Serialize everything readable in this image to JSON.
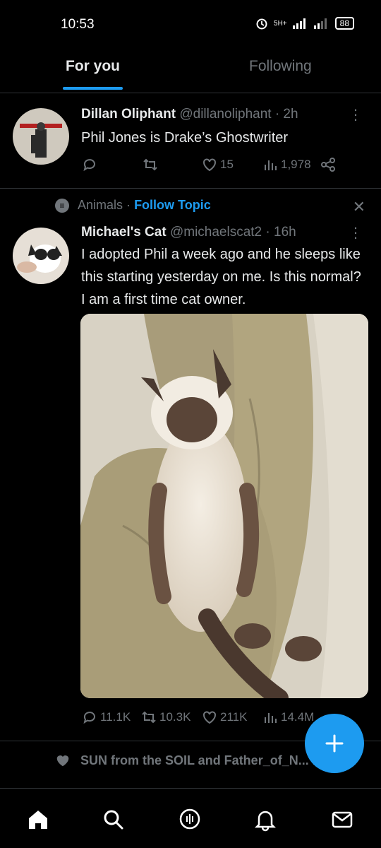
{
  "status_bar": {
    "time": "10:53",
    "network": "5H+",
    "battery": "88"
  },
  "tabs": [
    {
      "label": "For you",
      "active": true
    },
    {
      "label": "Following",
      "active": false
    }
  ],
  "tweet1": {
    "name": "Dillan Oliphant",
    "handle": "@dillanoliphant · 2h",
    "text": "Phil Jones is Drake’s Ghostwriter",
    "avatar_text": "DILLAN OLIPHANT\nRUBES VIOLENCE\nCOMEDY TOUR",
    "retweets": "",
    "likes": "15",
    "views": "1,978"
  },
  "topic": {
    "label": "Animals",
    "separator": "·",
    "follow": "Follow Topic"
  },
  "tweet2": {
    "name": "Michael's Cat",
    "handle": "@michaelscat2 · 16h",
    "text": "I adopted Phil a week ago and he sleeps like this starting yesterday on me. Is this normal? I am a first time cat owner.",
    "replies": "11.1K",
    "retweets": "10.3K",
    "likes": "211K",
    "views": "14.4M"
  },
  "liked": {
    "text": "SUN from the SOIL and Father_of_N... liked"
  },
  "colors": {
    "accent": "#1d9bf0",
    "background": "#000000",
    "text": "#e7e9ea",
    "muted": "#71767b",
    "divider": "#2f3336"
  },
  "icons": [
    "home-icon",
    "search-icon",
    "spaces-icon",
    "notifications-icon",
    "messages-icon",
    "compose-plus-icon"
  ]
}
